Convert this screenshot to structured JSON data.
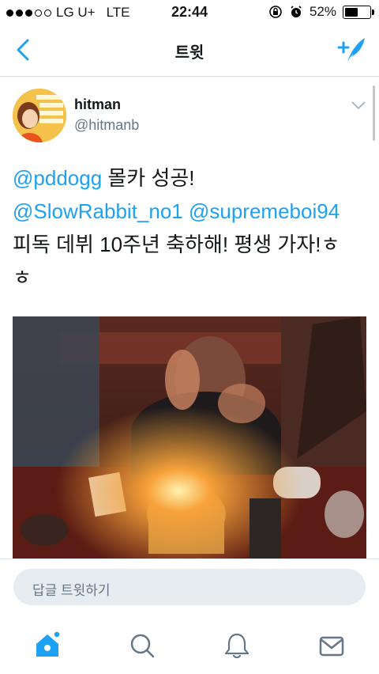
{
  "status_bar": {
    "carrier": "LG U+",
    "network": "LTE",
    "time": "22:44",
    "battery_percent": "52%",
    "battery_level": 0.52
  },
  "navbar": {
    "title": "트윗",
    "back_icon": "chevron-left-icon",
    "compose_icon": "compose-tweet-icon"
  },
  "author": {
    "name": "hitman",
    "handle": "@hitmanb"
  },
  "tweet": {
    "line1_mention": "@pddogg",
    "line1_text": " 몰카 성공!",
    "line2_mention1": "@SlowRabbit_no1",
    "line2_mention2": "@supremeboi94",
    "line3_text": "피독 데뷔 10주년 축하해! 평생 가자!ㅎ",
    "line4_text": "ㅎ"
  },
  "reply": {
    "placeholder": "답글 트윗하기"
  },
  "tabbar": {
    "items": [
      "home-icon",
      "search-icon",
      "notifications-icon",
      "messages-icon"
    ]
  },
  "colors": {
    "accent": "#1da1f2",
    "tab_icon": "#657786"
  }
}
